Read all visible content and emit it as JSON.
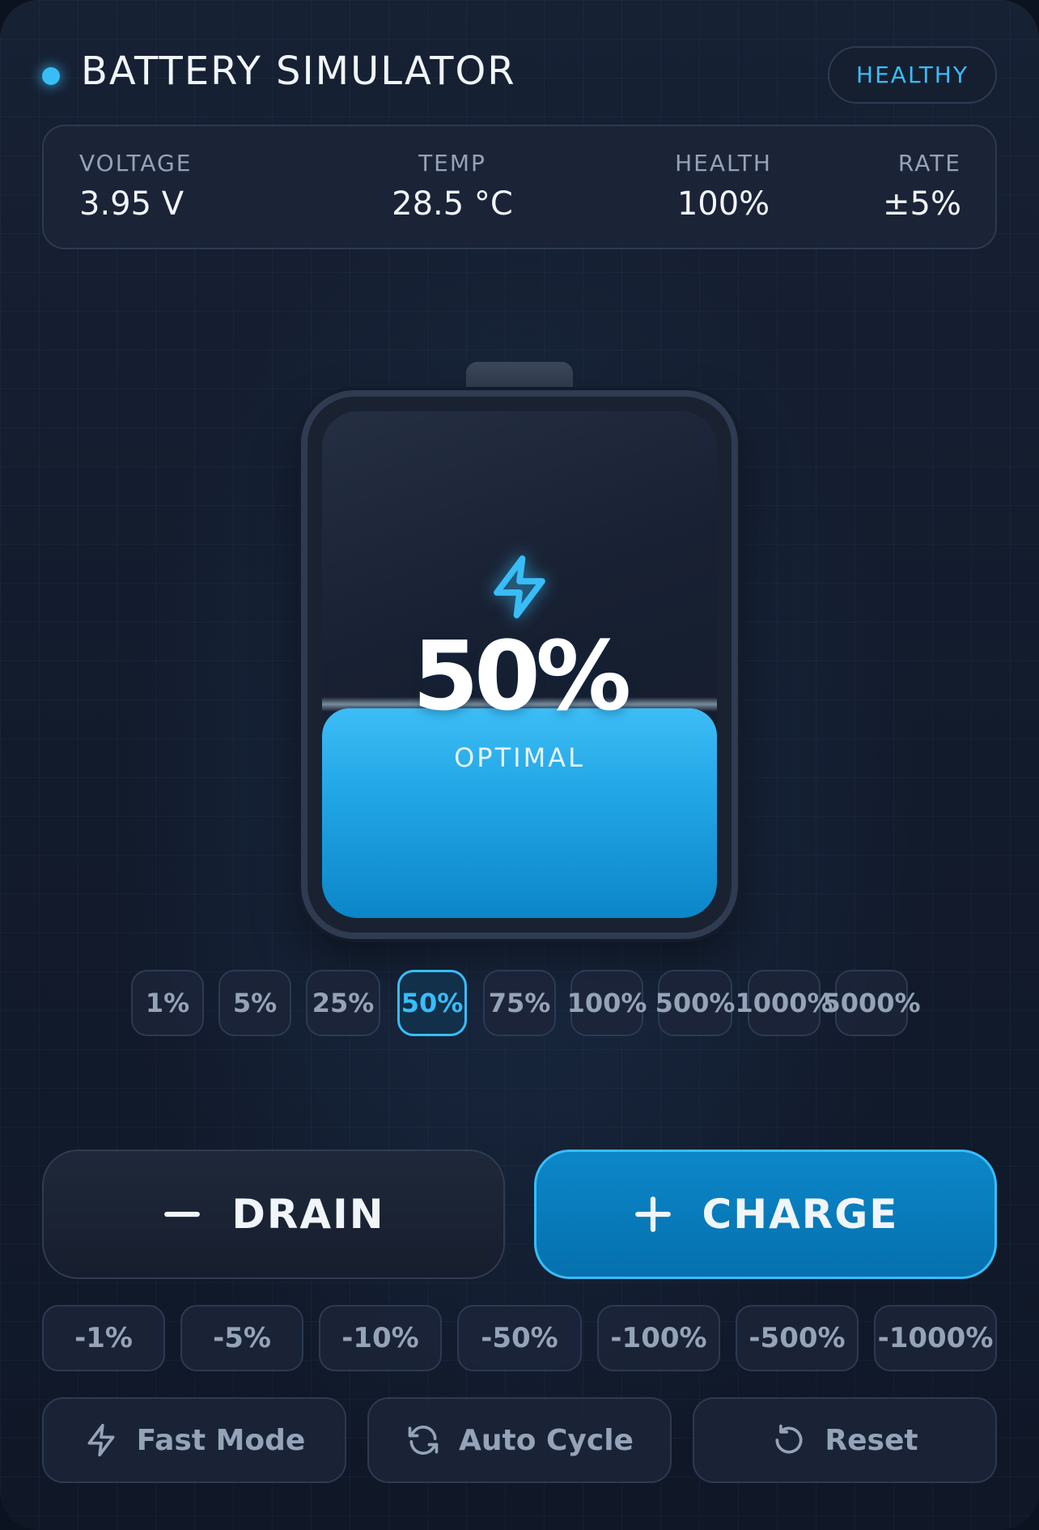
{
  "header": {
    "title": "BATTERY SIMULATOR",
    "status_badge": "HEALTHY",
    "accent_color": "#38bdf8"
  },
  "stats": [
    {
      "label": "VOLTAGE",
      "value": "3.95 V"
    },
    {
      "label": "TEMP",
      "value": "28.5 °C"
    },
    {
      "label": "HEALTH",
      "value": "100%"
    },
    {
      "label": "RATE",
      "value": "±5%"
    }
  ],
  "battery": {
    "level_fraction": 0.5,
    "percent_label": "50%",
    "state_label": "OPTIMAL",
    "icon": "bolt-icon"
  },
  "level_presets": {
    "selected": "50%",
    "items": [
      "1%",
      "5%",
      "25%",
      "50%",
      "75%",
      "100%",
      "500%",
      "1000%",
      "5000%"
    ]
  },
  "actions": {
    "drain_label": "DRAIN",
    "drain_icon": "minus-icon",
    "charge_label": "CHARGE",
    "charge_icon": "plus-icon"
  },
  "drain_steps": [
    "-1%",
    "-5%",
    "-10%",
    "-50%",
    "-100%",
    "-500%",
    "-1000%"
  ],
  "tools": [
    {
      "label": "Fast Mode",
      "icon": "bolt-icon"
    },
    {
      "label": "Auto Cycle",
      "icon": "refresh-icon"
    },
    {
      "label": "Reset",
      "icon": "reset-icon"
    }
  ]
}
